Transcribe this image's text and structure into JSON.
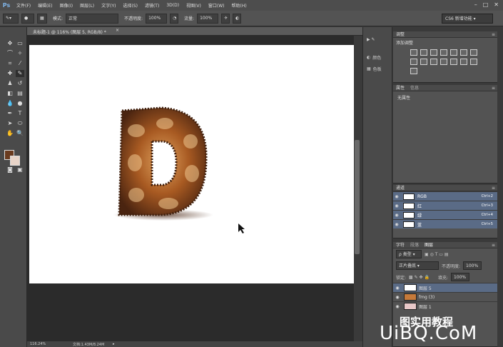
{
  "menu": {
    "logo": "Ps",
    "items": [
      "文件(F)",
      "编辑(E)",
      "图像(I)",
      "图层(L)",
      "文字(Y)",
      "选择(S)",
      "滤镜(T)",
      "3D(D)",
      "视图(V)",
      "窗口(W)",
      "帮助(H)"
    ],
    "window_controls": [
      "–",
      "□",
      "✕"
    ]
  },
  "options": {
    "mode_label": "模式:",
    "mode_value": "正常",
    "opacity_label": "不透明度:",
    "opacity_value": "100%",
    "flow_label": "流量:",
    "flow_value": "100%",
    "workspace": "CS6 新增功能"
  },
  "document": {
    "tab_title": "未标题-1 @ 116% (图层 5, RGB/8) *",
    "zoom": "116.24%",
    "doc_size": "文档:1.43M/8.24M"
  },
  "panel_strip": {
    "items": [
      "颜色",
      "色板"
    ]
  },
  "adjustments": {
    "title": "调整",
    "add_label": "添加调整"
  },
  "properties": {
    "tab1": "属性",
    "tab2": "信息",
    "content": "无属性"
  },
  "channels": {
    "title": "通道",
    "rows": [
      {
        "name": "RGB",
        "shortcut": "Ctrl+2"
      },
      {
        "name": "红",
        "shortcut": "Ctrl+3"
      },
      {
        "name": "绿",
        "shortcut": "Ctrl+4"
      },
      {
        "name": "蓝",
        "shortcut": "Ctrl+5"
      }
    ]
  },
  "layers": {
    "tabs": [
      "字符",
      "段落",
      "图层"
    ],
    "filter": "类型",
    "blend_mode": "正片叠底",
    "opacity_label": "不透明度:",
    "opacity_value": "100%",
    "lock_label": "锁定:",
    "fill_label": "填充:",
    "fill_value": "100%",
    "rows": [
      {
        "name": "图层 5"
      },
      {
        "name": "fmg (3)"
      },
      {
        "name": "图层 1"
      }
    ]
  },
  "watermark": {
    "text": "UiBQ.CoM",
    "cn": "图实用教程"
  },
  "colors": {
    "foreground": "#6a3b1f",
    "background": "#e8d4c8",
    "selection": "#5a6b86"
  }
}
